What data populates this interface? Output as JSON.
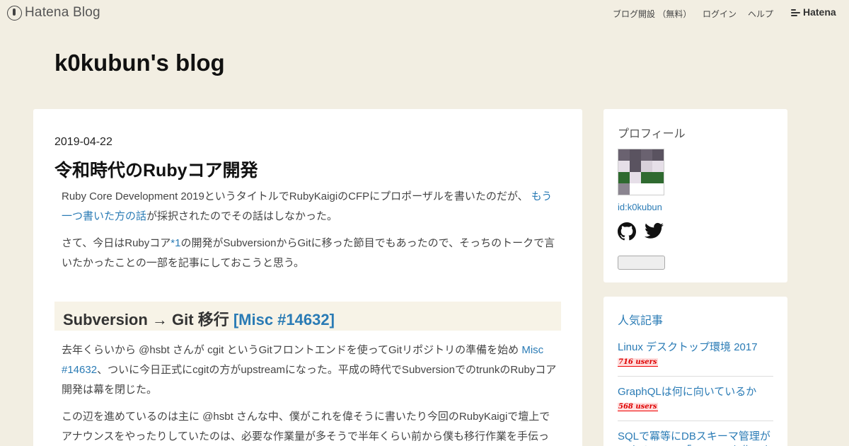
{
  "header": {
    "logo_text": "Hatena Blog",
    "links": [
      "ブログ開設 （無料）",
      "ログイン",
      "ヘルプ"
    ],
    "brand": "Hatena"
  },
  "blog": {
    "title": "k0kubun's blog"
  },
  "entry": {
    "date": "2019-04-22",
    "title": "令和時代のRubyコア開発",
    "p1_a": "Ruby Core Development 2019というタイトルでRubyKaigiのCFPにプロポーザルを書いたのだが、",
    "p1_link": "もう一つ書いた方の話",
    "p1_b": "が採択されたのでその話はしなかった。",
    "p2_a": "さて、今日はRubyコア",
    "p2_footnote": "*1",
    "p2_b": "の開発がSubversionからGitに移った節目でもあったので、そっちのトークで言いたかったことの一部を記事にしておこうと思う。",
    "h2_text": "Subversion → Git 移行 ",
    "h2_link": "[Misc #14632]",
    "p3_a": "去年くらいから @hsbt さんが cgit というGitフロントエンドを使ってGitリポジトリの準備を始め ",
    "p3_link": "Misc #14632",
    "p3_b": "、ついに今日正式にcgitの方がupstreamになった。平成の時代でSubversionでのtrunkのRubyコア開発は幕を閉じた。",
    "p4": "この辺を進めているのは主に @hsbt さんな中、僕がこれを偉そうに書いたり今回のRubyKaigiで壇上でアナウンスをやったりしていたのは、必要な作業量が多そうで半年くらい前から僕も移行作業を手伝っ"
  },
  "sidebar": {
    "profile_heading": "プロフィール",
    "profile_id": "id:k0kubun",
    "popular_heading": "人気記事",
    "popular": [
      {
        "title": "Linux デスクトップ環境 2017",
        "users": "716 users"
      },
      {
        "title": "GraphQLは何に向いているか",
        "users": "568 users"
      },
      {
        "title": "SQLで冪等にDBスキーマ管理ができるツール「sqldef」を作った",
        "users": ""
      }
    ]
  },
  "colors": {
    "background": "#f2eee2",
    "link": "#2a7bb5",
    "badge": "#dd0000"
  },
  "icons": [
    "hatena-blog-logo-icon",
    "hatena-brand-icon",
    "github-icon",
    "twitter-icon"
  ]
}
